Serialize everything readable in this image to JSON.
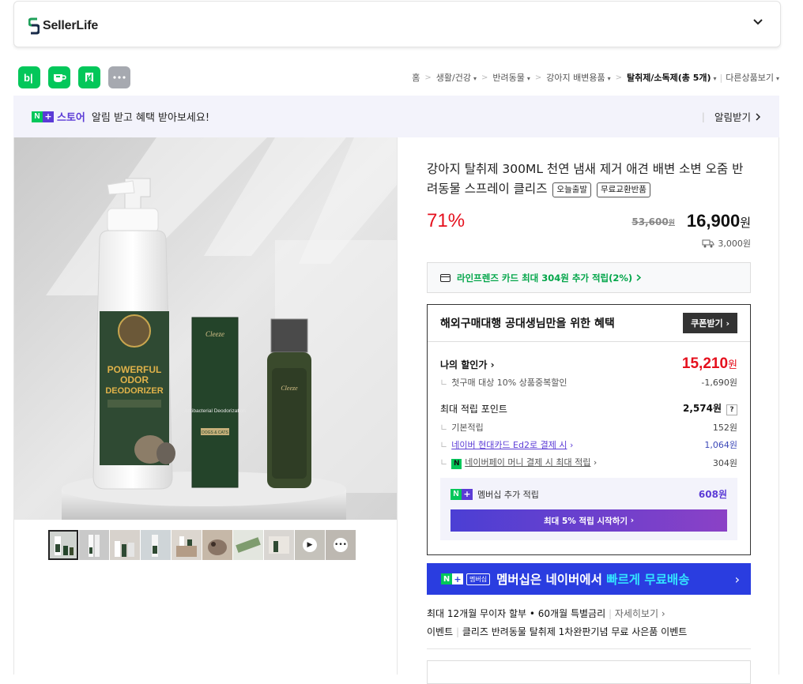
{
  "header": {
    "brand": "SellerLife",
    "expand_icon": "chevron-down-icon"
  },
  "apps": [
    {
      "name": "blog-app",
      "label": "b|",
      "color": "#03c75a"
    },
    {
      "name": "cafe-app",
      "label": "☕",
      "color": "#03c75a"
    },
    {
      "name": "bookmark-app",
      "label": "N",
      "color": "#03c75a"
    },
    {
      "name": "more-apps",
      "label": "•••",
      "color": "#a6a9b0"
    }
  ],
  "breadcrumb": {
    "home": "홈",
    "c1": "생활/건강",
    "c2": "반려동물",
    "c3": "강아지 배변용품",
    "c4": "탈취제/소독제(총 5개)",
    "other": "다른상품보기"
  },
  "notice": {
    "badge_n": "N",
    "badge_plus": "+",
    "store": "스토어",
    "text": "알림 받고 혜택 받아보세요!",
    "button": "알림받기"
  },
  "product": {
    "title": "강아지 탈취제 300ML 천연 냄새 제거 애견 배변 소변 오줌 반려동물 스프레이 클리즈",
    "tag1": "오늘출발",
    "tag2": "무료교환반품",
    "discount": "71%",
    "original_price": "53,600",
    "original_unit": "원",
    "price": "16,900",
    "price_unit": "원",
    "shipping": "3,000원"
  },
  "card_promo": "라인프렌즈 카드 최대 304원 추가 적립(2%)",
  "benefit": {
    "title": "해외구매대행 공대생님만을 위한 혜택",
    "coupon_button": "쿠폰받기",
    "my_price_label": "나의 할인가",
    "my_price": "15,210",
    "my_price_unit": "원",
    "first_purchase": "첫구매 대상 10% 상품중복할인",
    "first_purchase_val": "-1,690원",
    "points_label": "최대 적립 포인트",
    "points_val": "2,574원",
    "points_help": "?",
    "basic": "기본적립",
    "basic_val": "152원",
    "hyundai": "네이버 현대카드 Ed2로 결제 시",
    "hyundai_val": "1,064원",
    "npay_icon": "N",
    "npay": "네이버페이 머니 결제 시 최대 적립",
    "npay_val": "304원",
    "member_label": "멤버십 추가 적립",
    "member_val": "608원",
    "member_button": "최대 5% 적립 시작하기"
  },
  "banner": {
    "badge_n": "N",
    "badge_plus": "+",
    "badge_text": "멤버십",
    "text_main": "멤버십은 네이버에서 ",
    "text_highlight": "빠르게 무료배송"
  },
  "info": {
    "installment": "최대 12개월 무이자 할부 • 60개월 특별금리",
    "more": "자세히보기",
    "event_label": "이벤트",
    "event_text": "클리즈 반려동물 탈취제 1차완판기념 무료 사은품 이벤트"
  },
  "thumbnails": [
    {
      "name": "thumb-1",
      "selected": true
    },
    {
      "name": "thumb-2"
    },
    {
      "name": "thumb-3"
    },
    {
      "name": "thumb-4"
    },
    {
      "name": "thumb-5"
    },
    {
      "name": "thumb-6"
    },
    {
      "name": "thumb-7"
    },
    {
      "name": "thumb-8"
    },
    {
      "name": "thumb-video",
      "overlay": "▶"
    },
    {
      "name": "thumb-more",
      "overlay": "•••"
    }
  ],
  "product_image_text": {
    "bottle_line1": "POWERFUL",
    "bottle_line2": "ODOR",
    "bottle_line3": "DEODORIZER",
    "box_brand": "Cleeze",
    "box_text": "Antibacterial Deodorization",
    "box_label": "DOGS & CATS",
    "small_brand": "Cleeze"
  }
}
